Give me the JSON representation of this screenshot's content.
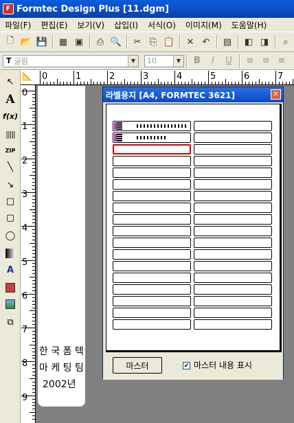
{
  "window": {
    "title": "Formtec Design Plus  [11.dgm]"
  },
  "menu": [
    "파일(F)",
    "편집(E)",
    "보기(V)",
    "삽입(I)",
    "서식(O)",
    "이미지(M)",
    "도움말(H)"
  ],
  "format_bar": {
    "font_value": "굴림",
    "size_value": "10"
  },
  "ruler": {
    "h_numbers": [
      "0",
      "1",
      "2",
      "3",
      "4",
      "5",
      "6",
      "7"
    ],
    "v_numbers": [
      "0",
      "1",
      "2",
      "3",
      "4",
      "5",
      "6",
      "7",
      "8",
      "9"
    ]
  },
  "page": {
    "line1": "한 국 폼 텍",
    "line2": "마 케 팅 팀",
    "line3": "2002년"
  },
  "dialog": {
    "title": "라벨용지 [A4, FORMTEC 3621]",
    "close_glyph": "✕",
    "rows": 18,
    "columns": 2,
    "selected_label": {
      "row": 3,
      "column": 1
    },
    "master_button": "마스터",
    "show_master_checked": true,
    "show_master_label": "마스터 내용 표시"
  }
}
